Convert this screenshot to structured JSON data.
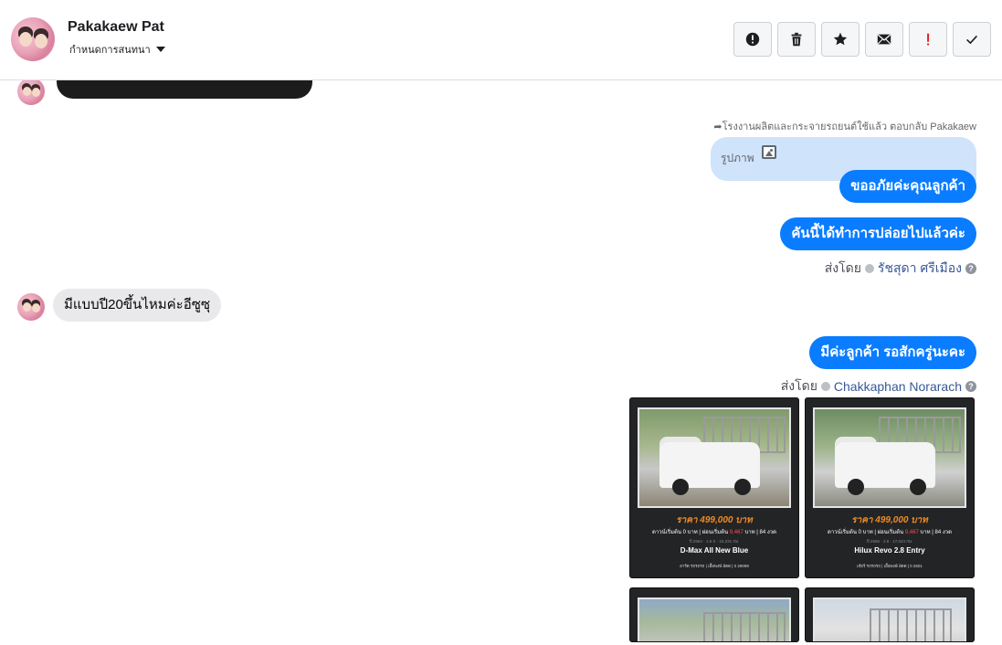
{
  "header": {
    "name": "Pakakaew Pat",
    "subtitle": "กำหนดการสนทนา",
    "actions": [
      {
        "name": "report-icon",
        "label": "Report"
      },
      {
        "name": "trash-icon",
        "label": "Delete"
      },
      {
        "name": "star-icon",
        "label": "Star"
      },
      {
        "name": "mail-icon",
        "label": "Mark unread"
      },
      {
        "name": "alert-icon",
        "label": "Important"
      },
      {
        "name": "check-icon",
        "label": "Done"
      }
    ],
    "colors": {
      "alert": "#e02020",
      "icon": "#1c1e21"
    }
  },
  "messages": {
    "reply_meta": "โรงงานผลิตและกระจายรถยนต์ใช้แล้ว ตอบกลับ Pakakaew",
    "reply_preview_label": "รูปภาพ",
    "out_1": "ขออภัยค่ะคุณลูกค้า",
    "out_2": "คันนี้ได้ทำการปล่อยไปแล้วค่ะ",
    "sent_by_1": {
      "prefix": "ส่งโดย",
      "who": "รัชสุดา ศรีเมือง",
      "help": "?"
    },
    "in_1": "มีแบบปี20ขึ้นไหมค่ะอีซูซุ",
    "out_3": "มีค่ะลูกค้า รอสักครู่นะคะ",
    "sent_by_2": {
      "prefix": "ส่งโดย",
      "who": "Chakkaphan Norarach",
      "help": "?"
    },
    "colors": {
      "outgoing": "#0a7cff",
      "incoming": "#e9e9eb",
      "reply": "#cfe3fb"
    }
  },
  "cards": [
    {
      "price": "ราคา 499,000 บาท",
      "terms_a": "ดาวน์เริ่มต้น 0 บาท | ผ่อนเริ่มต้น",
      "terms_hl": "9,467",
      "terms_b": "บาท | 84 งวด",
      "spec": "ปี 2564 · 1.9 S · 15,231 กม.",
      "model": "D-Max All New Blue",
      "foot": "อาร์ต รถรถรถ | เอื้อพงษ์ อัตต | 0 29099"
    },
    {
      "price": "ราคา 499,000 บาท",
      "terms_a": "ดาวน์เริ่มต้น 0 บาท | ผ่อนเริ่มต้น",
      "terms_hl": "9,467",
      "terms_b": "บาท | 84 งวด",
      "spec": "ปี 2565 · 2.8 · 17,024 กม.",
      "model": "Hilux Revo 2.8 Entry",
      "foot": "เจ๊ยร์ รถรถรถ | เอื้อพงษ์ อัตต | 0 2601"
    }
  ]
}
